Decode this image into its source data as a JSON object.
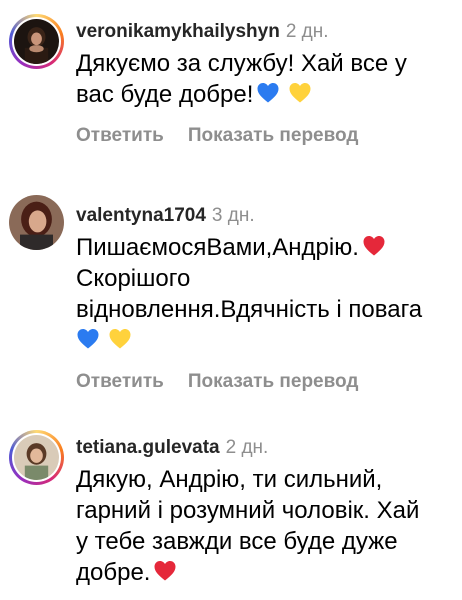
{
  "comments": [
    {
      "username": "veronikamykhailyshyn",
      "time": "2 дн.",
      "lines": [
        "Дякуємо за службу! Хай все у",
        "вас буде добре!"
      ],
      "reply_label": "Ответить",
      "translate_label": "Показать перевод"
    },
    {
      "username": "valentyna1704",
      "time": "3 дн.",
      "lines": [
        "ПишаємосяВами,Андрію.",
        "Скорішого",
        "відновлення.Вдячність і повага"
      ],
      "reply_label": "Ответить",
      "translate_label": "Показать перевод"
    },
    {
      "username": "tetiana.gulevata",
      "time": "2 дн.",
      "lines": [
        "Дякую, Андрію, ти сильний,",
        "гарний і розумний чоловік. Хай",
        "у тебе завжди все буде дуже",
        "добре."
      ]
    }
  ],
  "emoji": {
    "blue_heart": "blue-heart-icon",
    "yellow_heart": "yellow-heart-icon",
    "red_heart": "red-heart-icon"
  },
  "colors": {
    "blue_heart": "#2b7bf0",
    "yellow_heart": "#ffd23c",
    "red_heart": "#e5283a",
    "muted_text": "#8e8e8e"
  }
}
